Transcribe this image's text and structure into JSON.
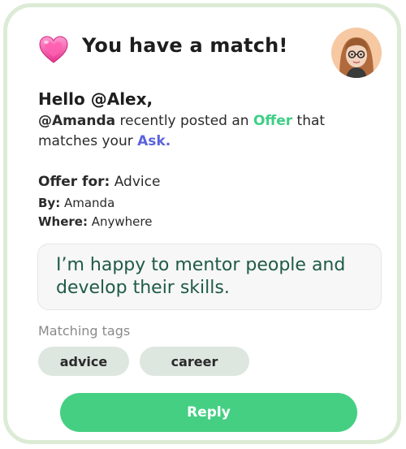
{
  "header": {
    "icon": "heart-icon",
    "title": "You have a match!"
  },
  "greeting": "Hello @Alex,",
  "message": {
    "handle": "@Amanda",
    "part1": " recently posted an ",
    "offer_word": "Offer",
    "part2": " that matches your ",
    "ask_word": "Ask."
  },
  "details": {
    "offer_label": "Offer for:",
    "offer_value": " Advice",
    "by_label": "By:",
    "by_value": " Amanda",
    "where_label": "Where:",
    "where_value": " Anywhere"
  },
  "quote": "I’m happy to mentor people and develop their skills.",
  "tags": {
    "label": "Matching tags",
    "items": [
      "advice",
      "career"
    ]
  },
  "reply_label": "Reply",
  "colors": {
    "card_border": "#dcebd5",
    "offer": "#3ecf86",
    "ask": "#5b63dd",
    "quote_text": "#1f5b45",
    "tag_bg": "#dde6df",
    "button": "#45cf83"
  }
}
